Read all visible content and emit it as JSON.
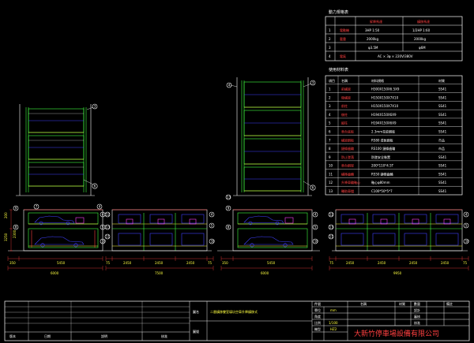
{
  "power_table": {
    "title": "動力規格表",
    "header": [
      "",
      "",
      "昇降馬達",
      "橫移馬達"
    ],
    "rows": [
      [
        "1",
        "電動機",
        "3HP 1:50",
        "1/2HP 1:60"
      ],
      [
        "2",
        "載重",
        "2000kg",
        "2000kg"
      ],
      [
        "3",
        "",
        "φ3.5M",
        "φ6M"
      ],
      [
        "4",
        "電氣",
        "AC × 3φ × 220V/380V",
        ""
      ]
    ]
  },
  "material_table": {
    "title": "使用材料表",
    "header": [
      "項目",
      "名稱",
      "材料規格",
      "材質"
    ],
    "rows": [
      [
        "1",
        "前橫梁",
        "H300X150X6.5X9",
        "SS41"
      ],
      [
        "2",
        "後橫梁",
        "H150X150X7X10",
        "SS41"
      ],
      [
        "3",
        "前柱",
        "H150X150X7X10",
        "SS41"
      ],
      [
        "4",
        "後柱",
        "H194X150X6X9",
        "SS41"
      ],
      [
        "5",
        "縱柱",
        "H194X150X6X9",
        "SS41"
      ],
      [
        "6",
        "車台底板",
        "2.3mm花紋鋼板",
        "SS41"
      ],
      [
        "7",
        "橫梁鋼板",
        "RS80 導軌鋼板",
        "市品"
      ],
      [
        "8",
        "鏈條齒輪",
        "RS100 鏈條齒輪",
        "市品"
      ],
      [
        "9",
        "防止墜落",
        "防墜安全裝置",
        "SS41"
      ],
      [
        "10",
        "車台鋼架",
        "200*110*4.5T",
        "SS41"
      ],
      [
        "11",
        "橫移齒輪",
        "RS50 鏈條齒輪",
        "SS41"
      ],
      [
        "12",
        "升降車輪軸心",
        "軸心φ80mm",
        "SS41"
      ],
      [
        "13",
        "輔助車擋",
        "C100*50*5*7",
        "SS41"
      ]
    ]
  },
  "dimensions": {
    "view1": [
      "350",
      "5450",
      "6000",
      "200",
      "3250",
      "2300"
    ],
    "view2": [
      "75",
      "2450",
      "2450",
      "2450",
      "75",
      "7500"
    ],
    "view3": [
      "350",
      "5450",
      "6000"
    ],
    "view4": [
      "75",
      "2450",
      "2450",
      "2450",
      "2450",
      "75",
      "9950"
    ]
  },
  "callouts": [
    "1",
    "2",
    "3",
    "4",
    "5",
    "6",
    "7",
    "8",
    "9",
    "10",
    "11",
    "12",
    "13"
  ],
  "title_block": {
    "drawing_name_label": "圖名",
    "drawing_name": "二層橫移雙室填坑空車升降橫移式",
    "drawing_no_label": "圖號",
    "unit_label": "單位",
    "unit_value": "mm",
    "angle_label": "角度",
    "scale_label": "比例",
    "scale_value": "1/100",
    "model_label": "機型",
    "model_value": "HZ2",
    "header_cols": [
      "件號",
      "名稱",
      "材質",
      "數量",
      "備註"
    ],
    "design_label": "設計",
    "check_label": "審核",
    "approve_label": "核准",
    "company": "大新竹停車場設備有限公司",
    "revision_cols": [
      "版本",
      "日期",
      "說明",
      "核准"
    ]
  }
}
